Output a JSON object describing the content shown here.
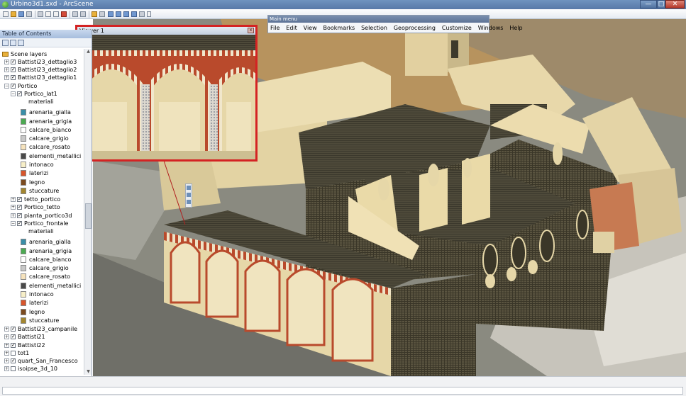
{
  "window": {
    "title": "Urbino3d1.sxd - ArcScene",
    "controls": {
      "minimize": "—",
      "maximize": "□",
      "close": "✕"
    }
  },
  "toolbar": {
    "icons": [
      "new-icon",
      "open-icon",
      "save-icon",
      "print-icon",
      "cut-icon",
      "copy-icon",
      "paste-icon",
      "delete-icon",
      "undo-icon",
      "redo-icon",
      "add-data-icon",
      "layer-icon",
      "catalog-icon",
      "toc-icon",
      "search-icon",
      "model-icon",
      "python-icon"
    ]
  },
  "toc": {
    "header": "Table of Contents",
    "tools": [
      "list-by-drawing-order-icon",
      "list-by-source-icon",
      "options-icon"
    ],
    "root": "Scene layers",
    "items": [
      {
        "label": "Battisti23_dettaglio3",
        "checked": true,
        "expanded": false
      },
      {
        "label": "Battisti23_dettaglio2",
        "checked": true,
        "expanded": false
      },
      {
        "label": "Battisti23_dettaglio1",
        "checked": true,
        "expanded": false
      },
      {
        "label": "Portico",
        "checked": true,
        "expanded": true
      },
      {
        "label": "Portico_lat1",
        "checked": true,
        "expanded": true
      },
      {
        "label": "materiali",
        "heading": true
      },
      {
        "label": "arenaria_gialla",
        "color": "#3a8ea8"
      },
      {
        "label": "arenaria_grigia",
        "color": "#4caa52"
      },
      {
        "label": "calcare_bianco",
        "color": "#ffffff"
      },
      {
        "label": "calcare_grigio",
        "color": "#c8c8c8"
      },
      {
        "label": "calcare_rosato",
        "color": "#f6e3bd"
      },
      {
        "label": "elementi_metallici",
        "color": "#4a4a4a"
      },
      {
        "label": "intonaco",
        "color": "#f7efc8"
      },
      {
        "label": "laterizi",
        "color": "#d8552b"
      },
      {
        "label": "legno",
        "color": "#7b4a1f"
      },
      {
        "label": "stuccature",
        "color": "#a3862f"
      },
      {
        "label": "tetto_portico",
        "checked": true,
        "expanded": false
      },
      {
        "label": "Portico_tetto",
        "checked": true,
        "expanded": false
      },
      {
        "label": "pianta_portico3d",
        "checked": true,
        "expanded": false
      },
      {
        "label": "Portico_frontale",
        "checked": true,
        "expanded": true
      },
      {
        "label": "materiali",
        "heading": true
      },
      {
        "label": "arenaria_gialla",
        "color": "#3a8ea8"
      },
      {
        "label": "arenaria_grigia",
        "color": "#4caa52"
      },
      {
        "label": "calcare_bianco",
        "color": "#ffffff"
      },
      {
        "label": "calcare_grigio",
        "color": "#c8c8c8"
      },
      {
        "label": "calcare_rosato",
        "color": "#f6e3bd"
      },
      {
        "label": "elementi_metallici",
        "color": "#4a4a4a"
      },
      {
        "label": "intonaco",
        "color": "#f7efc8"
      },
      {
        "label": "laterizi",
        "color": "#d8552b"
      },
      {
        "label": "legno",
        "color": "#7b4a1f"
      },
      {
        "label": "stuccature",
        "color": "#a3862f"
      },
      {
        "label": "Battisti23_campanile",
        "checked": true,
        "expanded": false
      },
      {
        "label": "Battisti21",
        "checked": true,
        "expanded": false
      },
      {
        "label": "Battisti22",
        "checked": true,
        "expanded": false
      },
      {
        "label": "tot1",
        "checked": false,
        "expanded": false
      },
      {
        "label": "quart_San_Francesco",
        "checked": true,
        "expanded": false
      },
      {
        "label": "isoipse_3d_10",
        "checked": false,
        "expanded": false
      }
    ]
  },
  "viewer": {
    "title": "Viewer 1",
    "close": "x"
  },
  "mainmenu": {
    "title": "Main menu",
    "items": [
      "File",
      "Edit",
      "View",
      "Bookmarks",
      "Selection",
      "Geoprocessing",
      "Customize",
      "Windows",
      "Help"
    ]
  },
  "colors": {
    "accent_red": "#d42323",
    "facade": "#e6d7a8",
    "brick": "#b94a2c",
    "roof": "#3d3a2c",
    "terrain": "#8a8a80"
  }
}
